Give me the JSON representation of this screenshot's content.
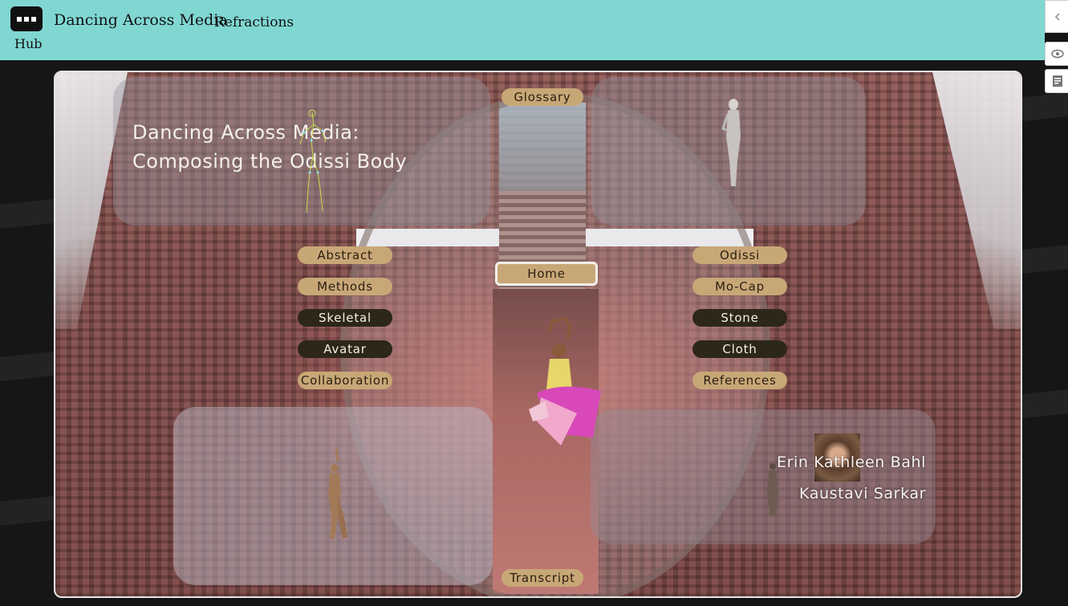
{
  "header": {
    "title": "Dancing Across Media",
    "subtitle": "Refractions",
    "hub_label": "Hub"
  },
  "side_buttons": [
    {
      "name": "collapse",
      "icon": "chevron-left-icon"
    },
    {
      "name": "visibility",
      "icon": "eye-icon"
    },
    {
      "name": "notes",
      "icon": "document-icon"
    }
  ],
  "main": {
    "title_line1": "Dancing Across Media:",
    "title_line2": "Composing the Odissi Body",
    "authors": [
      "Erin Kathleen Bahl",
      "Kaustavi Sarkar"
    ]
  },
  "nav": {
    "glossary": "Glossary",
    "home": "Home",
    "transcript": "Transcript",
    "left": [
      "Abstract",
      "Methods",
      "Skeletal",
      "Avatar",
      "Collaboration"
    ],
    "right": [
      "Odissi",
      "Mo-Cap",
      "Stone",
      "Cloth",
      "References"
    ]
  },
  "colors": {
    "header_bg": "#80d7d2",
    "pill_light": "#c8a777",
    "pill_dark": "#2c2719"
  }
}
